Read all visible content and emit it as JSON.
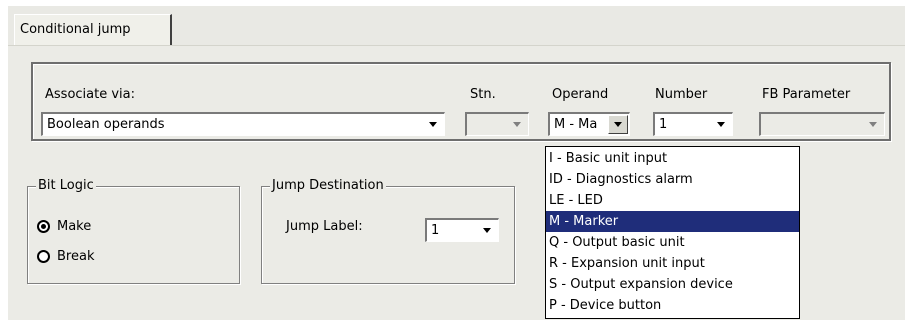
{
  "tab": {
    "label": "Conditional jump"
  },
  "associate": {
    "label": "Associate via:",
    "value": "Boolean operands"
  },
  "station": {
    "label": "Stn.",
    "value": ""
  },
  "operand": {
    "label": "Operand",
    "value": "M - Ma"
  },
  "number": {
    "label": "Number",
    "value": "1"
  },
  "fb_parameter": {
    "label": "FB Parameter",
    "value": ""
  },
  "bit_logic": {
    "title": "Bit Logic",
    "options": [
      {
        "label": "Make",
        "selected": true
      },
      {
        "label": "Break",
        "selected": false
      }
    ]
  },
  "jump_destination": {
    "title": "Jump Destination",
    "label": "Jump Label:",
    "value": "1"
  },
  "operand_list": {
    "items": [
      "I - Basic unit input",
      "ID - Diagnostics alarm",
      "LE - LED",
      "M - Marker",
      "Q - Output basic unit",
      "R - Expansion unit input",
      "S - Output expansion device",
      "P - Device button"
    ],
    "selected_index": 3
  },
  "colors": {
    "selection": "#1f2d7a",
    "panel": "#ebebe6"
  }
}
